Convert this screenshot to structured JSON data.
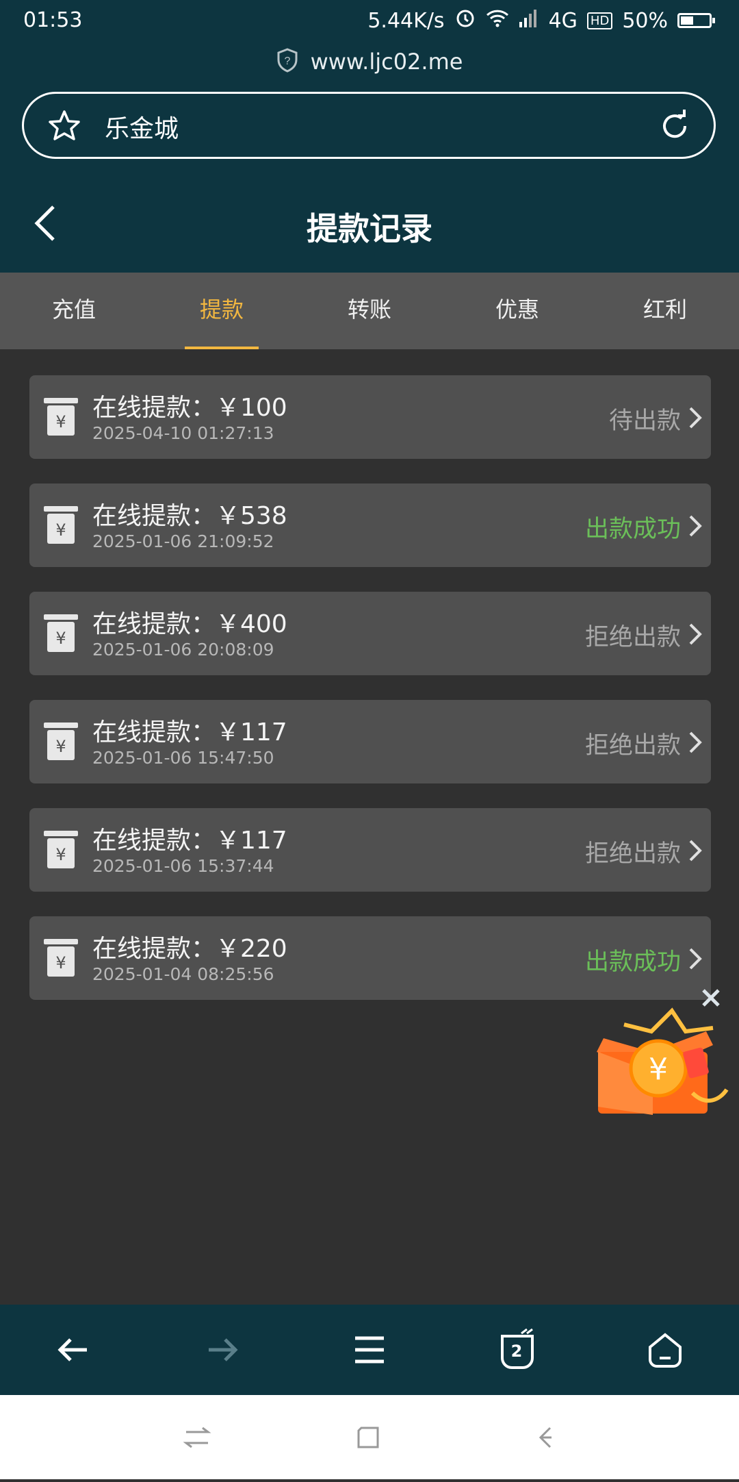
{
  "status_bar": {
    "time": "01:53",
    "net_speed": "5.44K/s",
    "network": "4G",
    "hd": "HD",
    "battery": "50%",
    "battery_level": 0.5
  },
  "browser": {
    "url": "www.ljc02.me",
    "site_name": "乐金城"
  },
  "page": {
    "title": "提款记录"
  },
  "tabs": [
    {
      "label": "充值"
    },
    {
      "label": "提款",
      "active": true
    },
    {
      "label": "转账"
    },
    {
      "label": "优惠"
    },
    {
      "label": "红利"
    }
  ],
  "records": [
    {
      "title": "在线提款：￥100",
      "time": "2025-04-10 01:27:13",
      "status": "待出款",
      "kind": "pending"
    },
    {
      "title": "在线提款：￥538",
      "time": "2025-01-06 21:09:52",
      "status": "出款成功",
      "kind": "success"
    },
    {
      "title": "在线提款：￥400",
      "time": "2025-01-06 20:08:09",
      "status": "拒绝出款",
      "kind": "reject"
    },
    {
      "title": "在线提款：￥117",
      "time": "2025-01-06 15:47:50",
      "status": "拒绝出款",
      "kind": "reject"
    },
    {
      "title": "在线提款：￥117",
      "time": "2025-01-06 15:37:44",
      "status": "拒绝出款",
      "kind": "reject"
    },
    {
      "title": "在线提款：￥220",
      "time": "2025-01-04 08:25:56",
      "status": "出款成功",
      "kind": "success"
    }
  ],
  "bottom_nav": {
    "tab_count": "2"
  },
  "colors": {
    "header_bg": "#0d3540",
    "accent": "#f2b740",
    "success": "#6bbf59",
    "muted": "#a8a8a8"
  },
  "icons": [
    "shield-icon",
    "star-icon",
    "reload-icon",
    "back-icon",
    "receipt-yen-icon",
    "chevron-right-icon",
    "gift-box-icon",
    "close-icon",
    "arrow-left-icon",
    "arrow-right-icon",
    "menu-icon",
    "tabs-icon",
    "home-icon"
  ]
}
